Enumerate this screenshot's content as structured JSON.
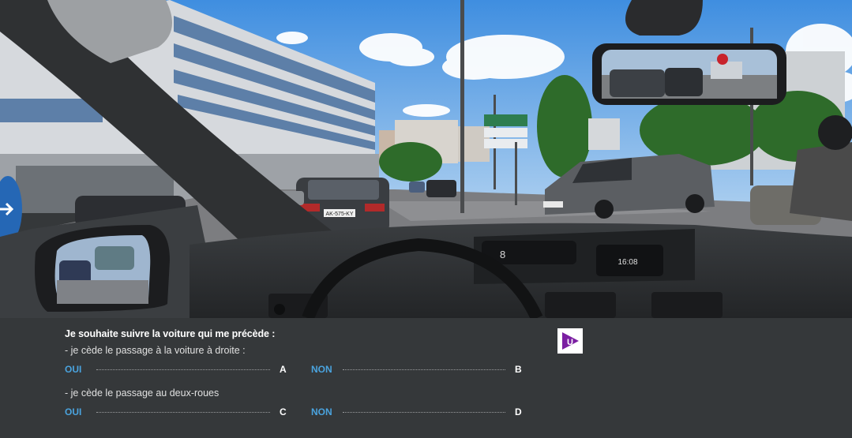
{
  "question": {
    "title": "Je souhaite suivre la voiture qui me précède :",
    "q1": {
      "text": "- je cède le passage à la voiture à droite :",
      "yes": {
        "label": "OUI",
        "key": "A"
      },
      "no": {
        "label": "NON",
        "key": "B"
      }
    },
    "q2": {
      "text": "- je cède le passage au deux-roues",
      "yes": {
        "label": "OUI",
        "key": "C"
      },
      "no": {
        "label": "NON",
        "key": "D"
      }
    }
  },
  "dashboard": {
    "clock": "16:08",
    "speed_digit": "8"
  },
  "plates": {
    "front_car": "AK-575-KY"
  },
  "logo": {
    "letter": "U",
    "icon": "play-logo-icon"
  },
  "colors": {
    "panel_bg": "#35383a",
    "answer_label": "#4aa3de",
    "logo_purple": "#7b1fa2"
  }
}
